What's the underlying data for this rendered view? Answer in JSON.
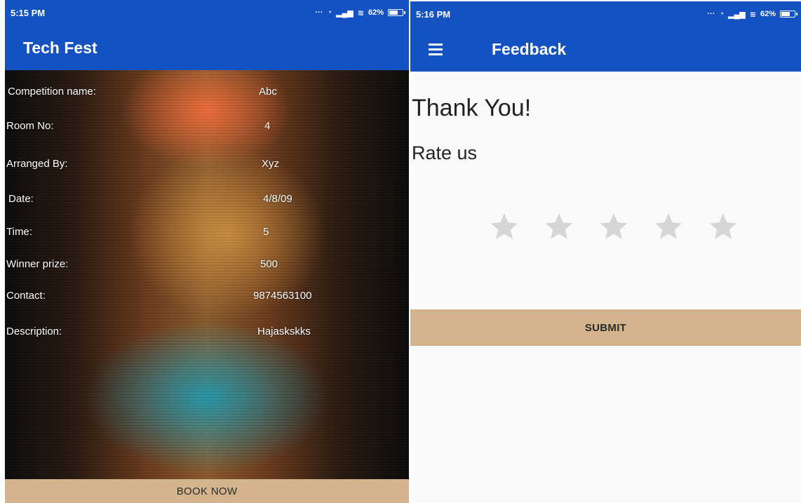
{
  "left": {
    "status": {
      "time": "5:15 PM",
      "battery": "62%"
    },
    "app_title": "Tech Fest",
    "details": [
      {
        "label": "Competition name:",
        "value": "Abc"
      },
      {
        "label": "Room No:",
        "value": "4"
      },
      {
        "label": "Arranged By:",
        "value": "Xyz"
      },
      {
        "label": "Date:",
        "value": "4/8/09"
      },
      {
        "label": "Time:",
        "value": "5"
      },
      {
        "label": "Winner prize:",
        "value": "500"
      },
      {
        "label": "Contact:",
        "value": "9874563100"
      },
      {
        "label": "Description:",
        "value": "Hajaskskks"
      }
    ],
    "book_button": "BOOK NOW"
  },
  "right": {
    "status": {
      "time": "5:16 PM",
      "battery": "62%"
    },
    "app_title": "Feedback",
    "menu_icon": "menu-icon",
    "thank_you": "Thank You!",
    "rate_label": "Rate us",
    "rating": {
      "value": 0,
      "max": 5
    },
    "submit_button": "SUBMIT"
  },
  "colors": {
    "app_bar": "#1552c1",
    "button": "#d4b48c",
    "star_empty": "#d6d6d6"
  }
}
